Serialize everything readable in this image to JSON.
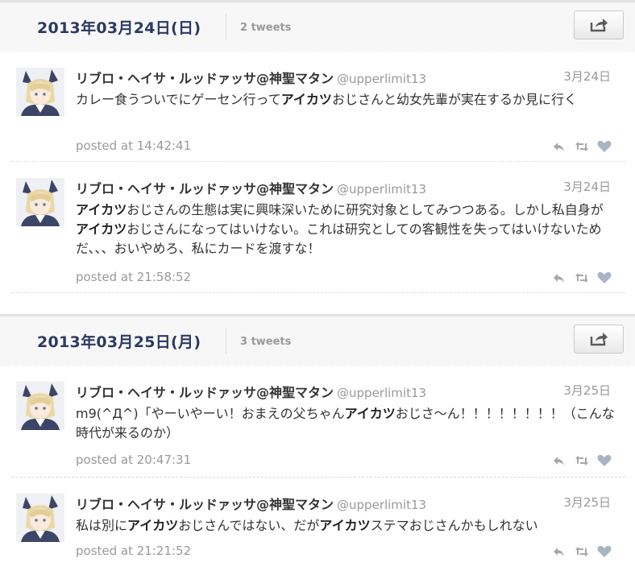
{
  "days": [
    {
      "date": "2013年03月24日(日)",
      "count": "2 tweets",
      "tweets": [
        {
          "name": "リブロ・ヘイサ・ルッドァッサ@神聖マタン",
          "handle": "@upperlimit13",
          "date": "3月24日",
          "segments": [
            {
              "t": "カレー食うついでにゲーセン行って"
            },
            {
              "t": "アイカツ",
              "b": true
            },
            {
              "t": "おじさんと幼女先輩が実在するか見に行く"
            }
          ],
          "posted": "posted at 14:42:41"
        },
        {
          "name": "リブロ・ヘイサ・ルッドァッサ@神聖マタン",
          "handle": "@upperlimit13",
          "date": "3月24日",
          "segments": [
            {
              "t": "アイカツ",
              "b": true
            },
            {
              "t": "おじさんの生態は実に興味深いために研究対象としてみつつある。しかし私自身が"
            },
            {
              "t": "アイカツ",
              "b": true
            },
            {
              "t": "おじさんになってはいけない。これは研究としての客観性を失ってはいけないためだ、、、おいやめろ、私にカードを渡すな！"
            }
          ],
          "posted": "posted at 21:58:52"
        }
      ]
    },
    {
      "date": "2013年03月25日(月)",
      "count": "3 tweets",
      "tweets": [
        {
          "name": "リブロ・ヘイサ・ルッドァッサ@神聖マタン",
          "handle": "@upperlimit13",
          "date": "3月25日",
          "segments": [
            {
              "t": "m9(^Д^)「やーいやーい！おまえの父ちゃん"
            },
            {
              "t": "アイカツ",
              "b": true
            },
            {
              "t": "おじさ～ん！！！！！！！！（こんな時代が来るのか）"
            }
          ],
          "posted": "posted at 20:47:31"
        },
        {
          "name": "リブロ・ヘイサ・ルッドァッサ@神聖マタン",
          "handle": "@upperlimit13",
          "date": "3月25日",
          "segments": [
            {
              "t": "私は別に"
            },
            {
              "t": "アイカツ",
              "b": true
            },
            {
              "t": "おじさんではない、だが"
            },
            {
              "t": "アイカツ",
              "b": true
            },
            {
              "t": "ステマおじさんかもしれない"
            }
          ],
          "posted": "posted at 21:21:52"
        }
      ]
    }
  ]
}
